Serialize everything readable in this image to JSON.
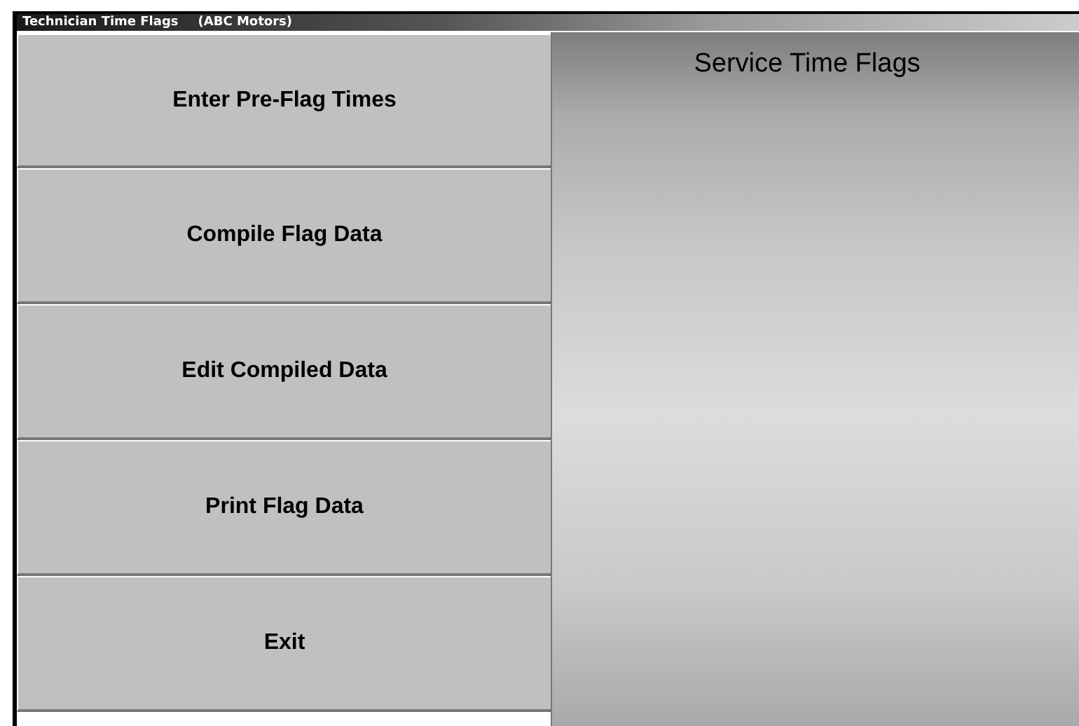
{
  "window": {
    "title": "Technician Time Flags",
    "subtitle": "(ABC Motors)"
  },
  "menu_buttons": [
    {
      "label": "Enter Pre-Flag Times"
    },
    {
      "label": "Compile Flag Data"
    },
    {
      "label": "Edit Compiled Data"
    },
    {
      "label": "Print Flag Data"
    },
    {
      "label": "Exit"
    }
  ],
  "panel": {
    "title": "Service Time Flags"
  }
}
